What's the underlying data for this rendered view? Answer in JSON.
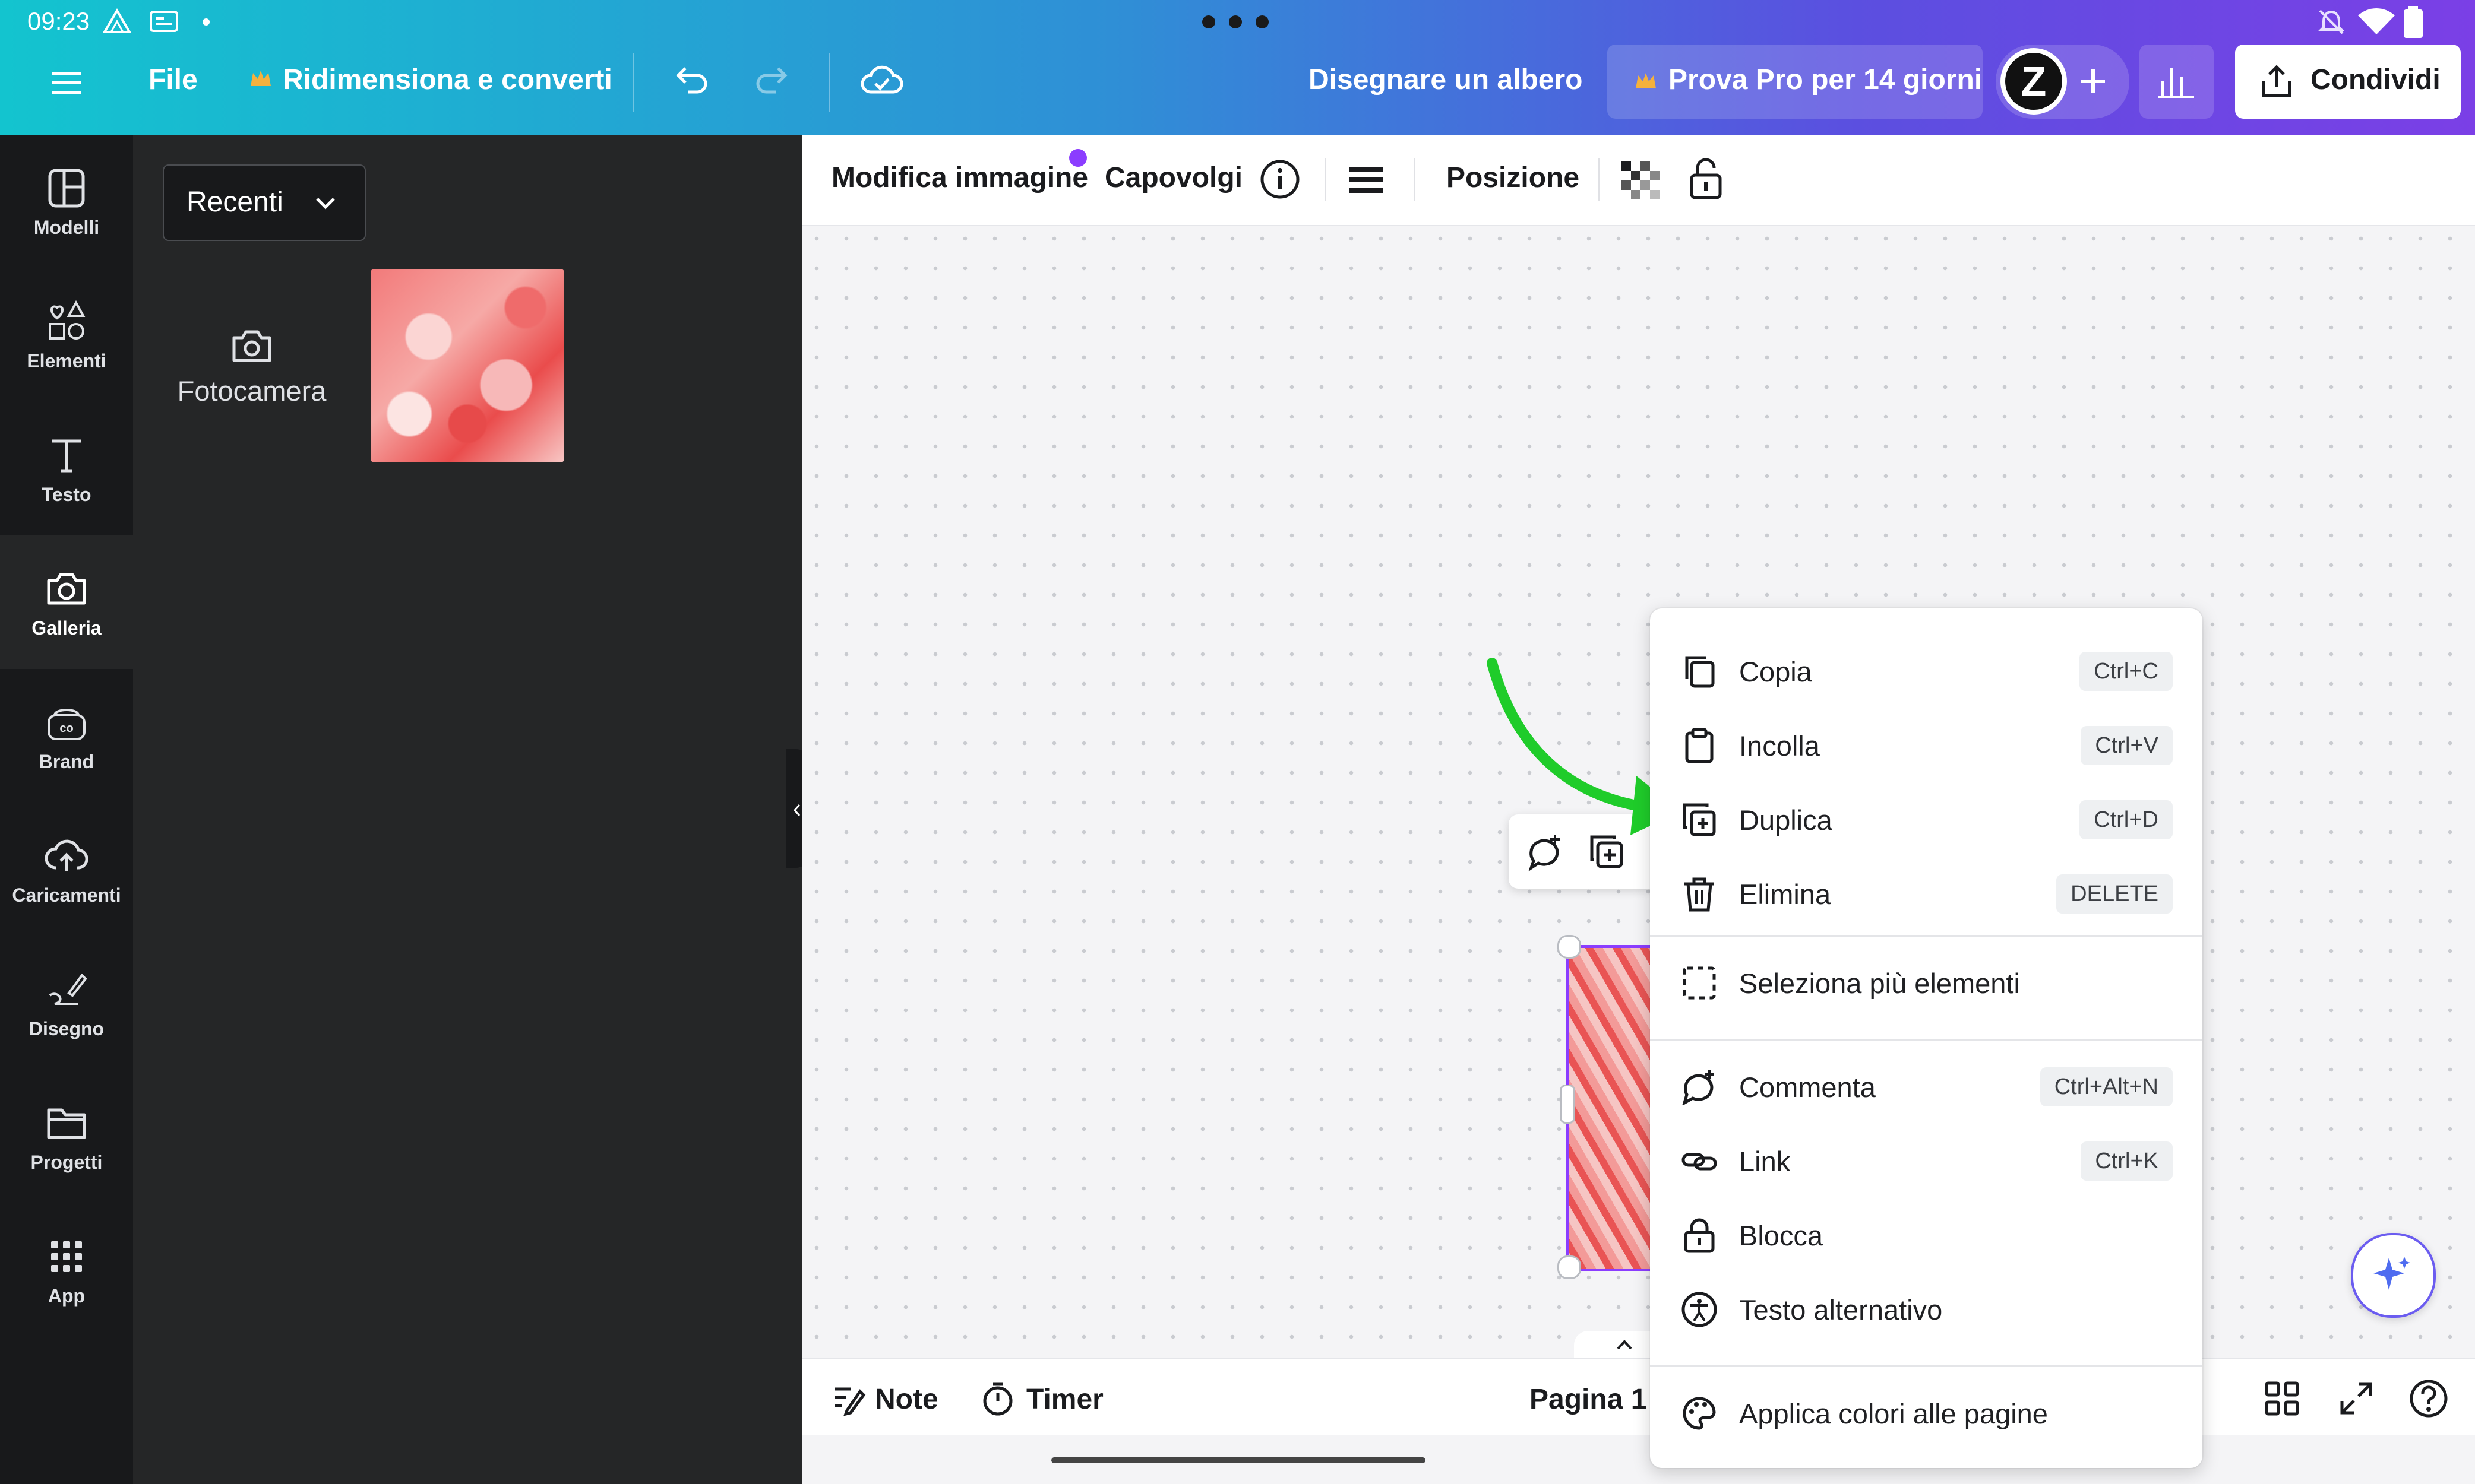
{
  "status_bar": {
    "time": "09:23"
  },
  "topbar": {
    "file_label": "File",
    "resize_label": "Ridimensiona e converti",
    "design_title": "Disegnare un albero",
    "pro_trial_label": "Prova Pro per 14 giorni",
    "avatar_letter": "Z",
    "share_label": "Condividi"
  },
  "sidebar": {
    "items": [
      {
        "label": "Modelli"
      },
      {
        "label": "Elementi"
      },
      {
        "label": "Testo"
      },
      {
        "label": "Galleria"
      },
      {
        "label": "Brand"
      },
      {
        "label": "Caricamenti"
      },
      {
        "label": "Disegno"
      },
      {
        "label": "Progetti"
      },
      {
        "label": "App"
      }
    ]
  },
  "panel": {
    "dropdown_value": "Recenti",
    "camera_label": "Fotocamera"
  },
  "context_toolbar": {
    "edit_image_label": "Modifica immagine",
    "flip_label": "Capovolgi",
    "position_label": "Posizione"
  },
  "context_menu": {
    "items": [
      {
        "label": "Copia",
        "shortcut": "Ctrl+C"
      },
      {
        "label": "Incolla",
        "shortcut": "Ctrl+V"
      },
      {
        "label": "Duplica",
        "shortcut": "Ctrl+D"
      },
      {
        "label": "Elimina",
        "shortcut": "DELETE"
      },
      {
        "label": "Seleziona più elementi",
        "shortcut": ""
      },
      {
        "label": "Commenta",
        "shortcut": "Ctrl+Alt+N"
      },
      {
        "label": "Link",
        "shortcut": "Ctrl+K"
      },
      {
        "label": "Blocca",
        "shortcut": ""
      },
      {
        "label": "Testo alternativo",
        "shortcut": ""
      },
      {
        "label": "Applica colori alle pagine",
        "shortcut": ""
      }
    ]
  },
  "bottom_bar": {
    "notes_label": "Note",
    "timer_label": "Timer",
    "page_label": "Pagina 1 /"
  },
  "colors": {
    "accent_purple": "#8b3dff",
    "arrow_green": "#1fcc2a",
    "crown_gold": "#f5b13d"
  }
}
